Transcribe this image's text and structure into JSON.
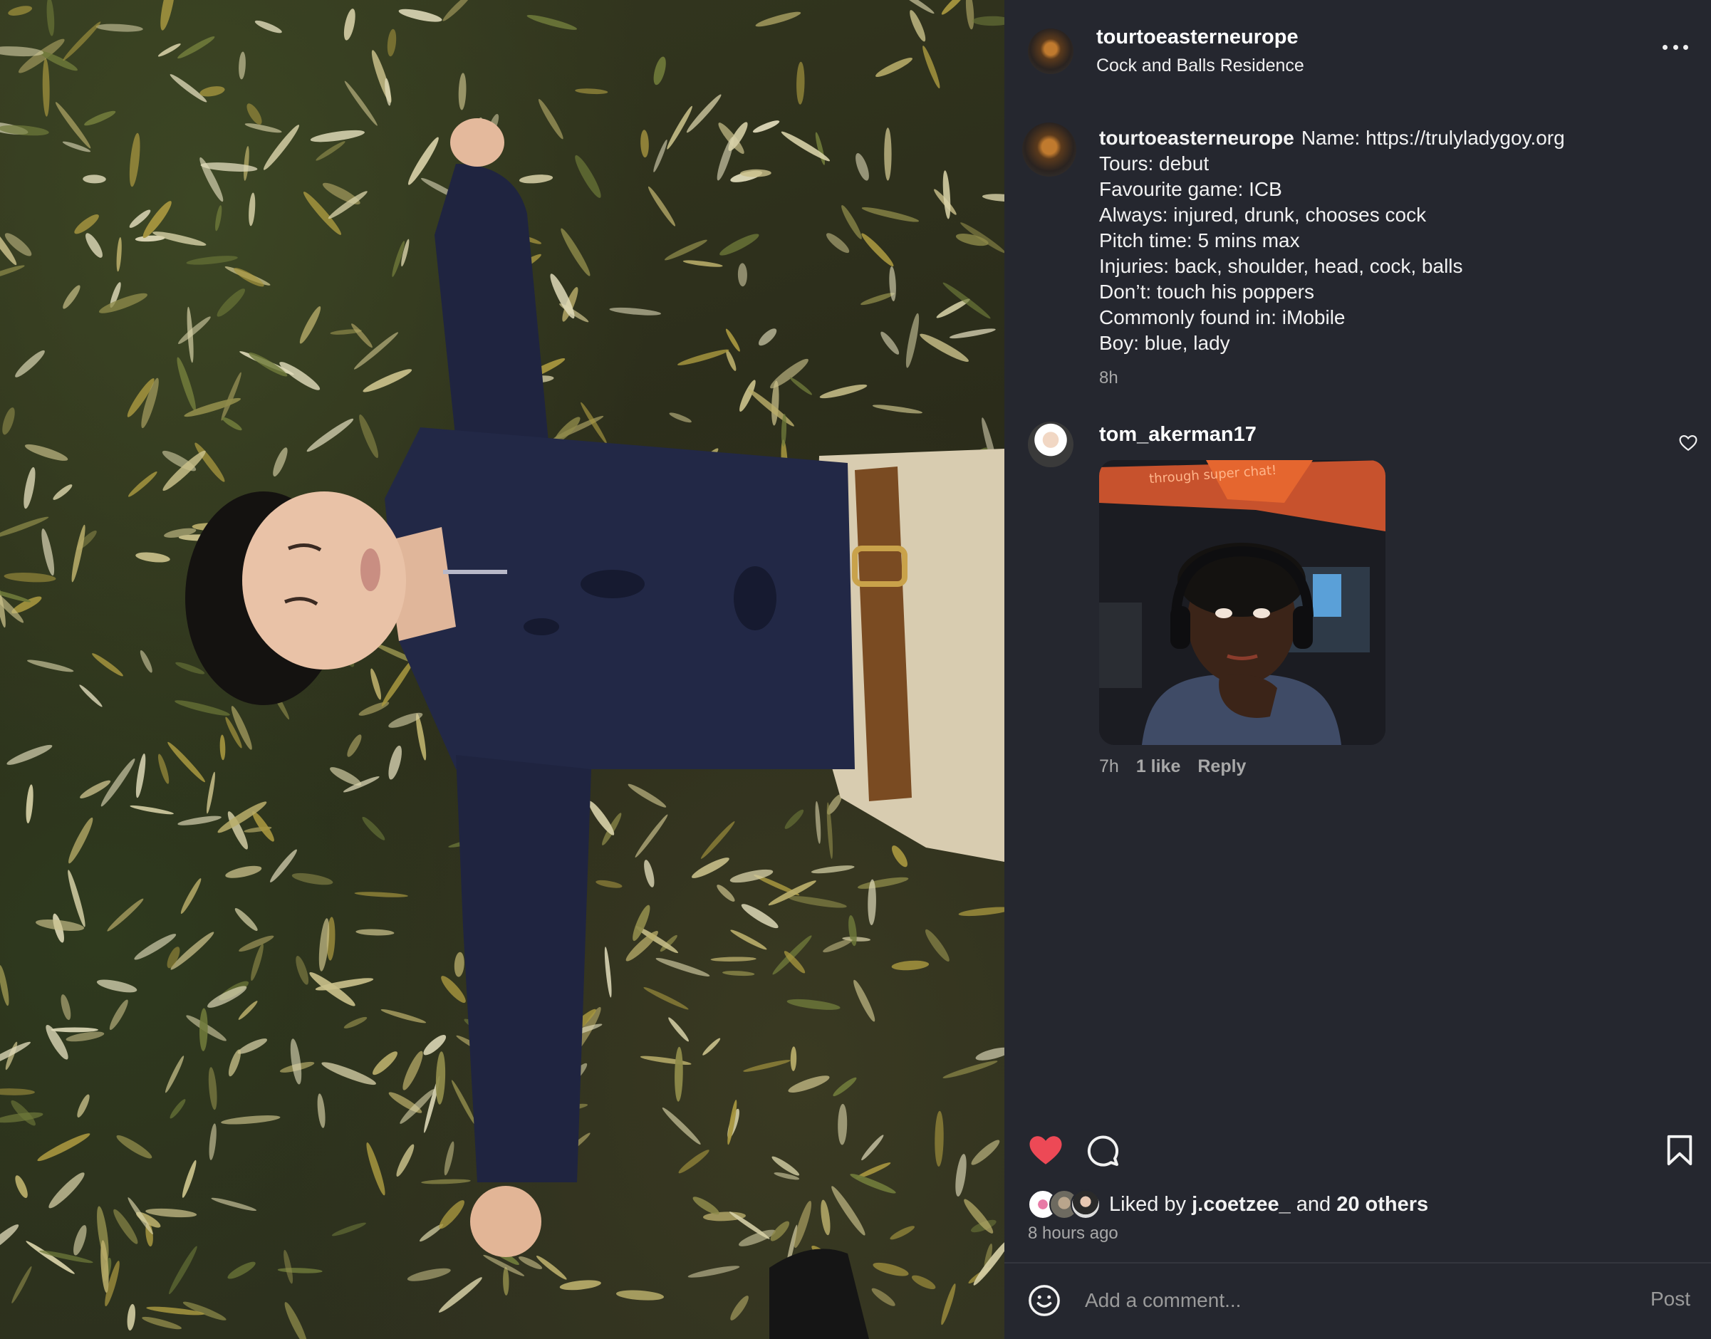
{
  "post": {
    "username": "tourtoeasterneurope",
    "location": "Cock and Balls Residence"
  },
  "caption": {
    "username": "tourtoeasterneurope",
    "first_line": "Name: https://trulyladygoy.org",
    "lines": [
      "Tours: debut",
      "Favourite game: ICB",
      "Always: injured, drunk, chooses cock",
      "Pitch time: 5 mins max",
      "Injuries: back, shoulder, head, cock, balls",
      "Don’t: touch his poppers",
      "Commonly found in: iMobile",
      "Boy: blue, lady"
    ],
    "time": "8h"
  },
  "comment": {
    "username": "tom_akerman17",
    "gif_caption": "through super chat!",
    "time": "7h",
    "likes": "1 like",
    "reply": "Reply"
  },
  "actions": {
    "liked_prefix": "Liked by",
    "liked_user": "j.coetzee_",
    "liked_and": "and",
    "liked_others": "20 others",
    "time_ago": "8 hours ago",
    "like_color": "#ed4956"
  },
  "comment_box": {
    "placeholder": "Add a comment...",
    "post_label": "Post"
  },
  "icons": {
    "more": "more-options-icon",
    "heart": "heart-icon",
    "comment": "comment-icon",
    "bookmark": "bookmark-icon",
    "emoji": "emoji-icon"
  }
}
